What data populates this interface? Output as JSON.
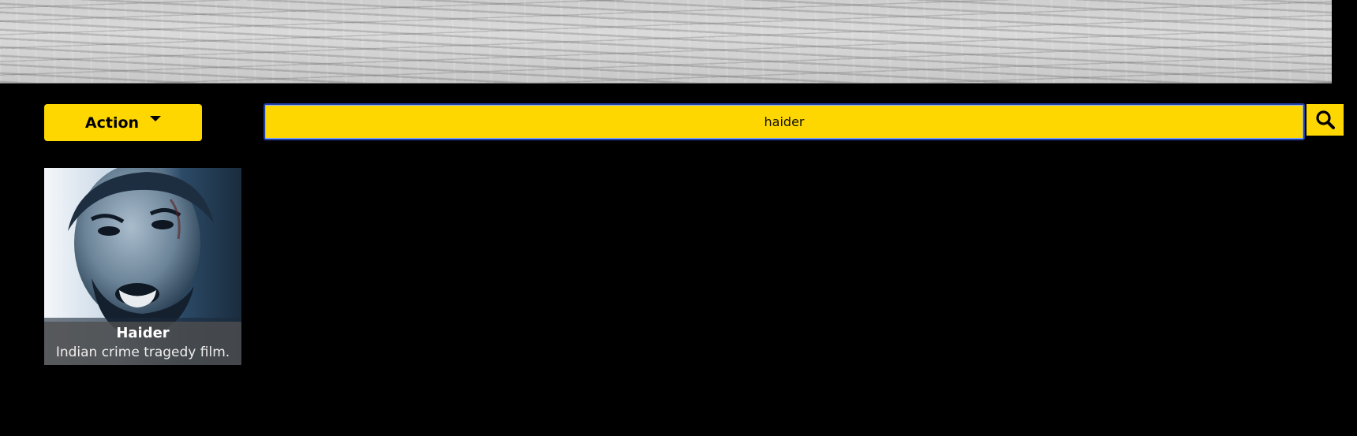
{
  "filter": {
    "genre_selected": "Action"
  },
  "search": {
    "value": "haider"
  },
  "results": [
    {
      "title": "Haider",
      "description": "Indian crime tragedy film."
    }
  ],
  "colors": {
    "accent": "#ffd700",
    "background": "#000000",
    "focus_border": "#1f3fa8"
  },
  "icons": {
    "search": "search-icon",
    "dropdown": "chevron-down-icon"
  }
}
